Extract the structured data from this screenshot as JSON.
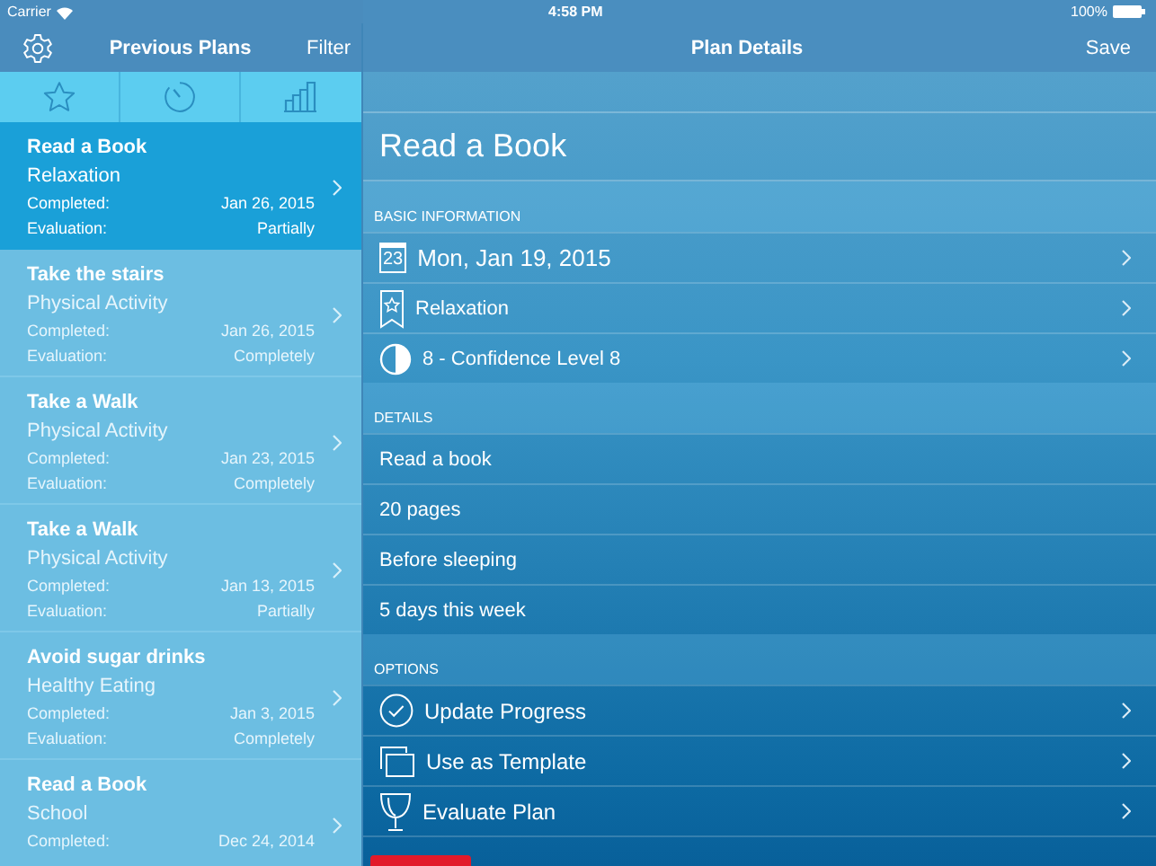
{
  "status_bar": {
    "carrier": "Carrier",
    "time": "4:58 PM",
    "battery": "100%"
  },
  "sidebar": {
    "title": "Previous Plans",
    "filter": "Filter",
    "items": [
      {
        "title": "Read a Book",
        "category": "Relaxation",
        "completed_label": "Completed:",
        "completed": "Jan 26, 2015",
        "evaluation_label": "Evaluation:",
        "evaluation": "Partially",
        "selected": true
      },
      {
        "title": "Take the stairs",
        "category": "Physical Activity",
        "completed_label": "Completed:",
        "completed": "Jan 26, 2015",
        "evaluation_label": "Evaluation:",
        "evaluation": "Completely",
        "selected": false
      },
      {
        "title": "Take a Walk",
        "category": "Physical Activity",
        "completed_label": "Completed:",
        "completed": "Jan 23, 2015",
        "evaluation_label": "Evaluation:",
        "evaluation": "Completely",
        "selected": false
      },
      {
        "title": "Take a Walk",
        "category": "Physical Activity",
        "completed_label": "Completed:",
        "completed": "Jan 13, 2015",
        "evaluation_label": "Evaluation:",
        "evaluation": "Partially",
        "selected": false
      },
      {
        "title": "Avoid sugar drinks",
        "category": "Healthy Eating",
        "completed_label": "Completed:",
        "completed": "Jan 3, 2015",
        "evaluation_label": "Evaluation:",
        "evaluation": "Completely",
        "selected": false
      },
      {
        "title": "Read a Book",
        "category": "School",
        "completed_label": "Completed:",
        "completed": "Dec 24, 2014",
        "selected": false
      }
    ]
  },
  "detail": {
    "title": "Plan Details",
    "save": "Save",
    "plan_name": "Read a Book",
    "sections": [
      {
        "header": "BASIC INFORMATION",
        "rows": [
          {
            "kind": "date",
            "icon_text": "23",
            "text": "Mon, Jan 19, 2015"
          },
          {
            "kind": "category",
            "text": "Relaxation"
          },
          {
            "kind": "confidence",
            "text": "8 - Confidence Level 8"
          }
        ]
      },
      {
        "header": "DETAILS",
        "rows": [
          {
            "kind": "plain",
            "text": "Read a book"
          },
          {
            "kind": "plain",
            "text": "20 pages"
          },
          {
            "kind": "plain",
            "text": "Before sleeping"
          },
          {
            "kind": "plain",
            "text": "5 days this week"
          }
        ]
      },
      {
        "header": "OPTIONS",
        "rows": [
          {
            "kind": "progress",
            "text": "Update Progress"
          },
          {
            "kind": "template",
            "text": "Use as Template"
          },
          {
            "kind": "evaluate",
            "text": "Evaluate Plan"
          }
        ]
      }
    ]
  }
}
